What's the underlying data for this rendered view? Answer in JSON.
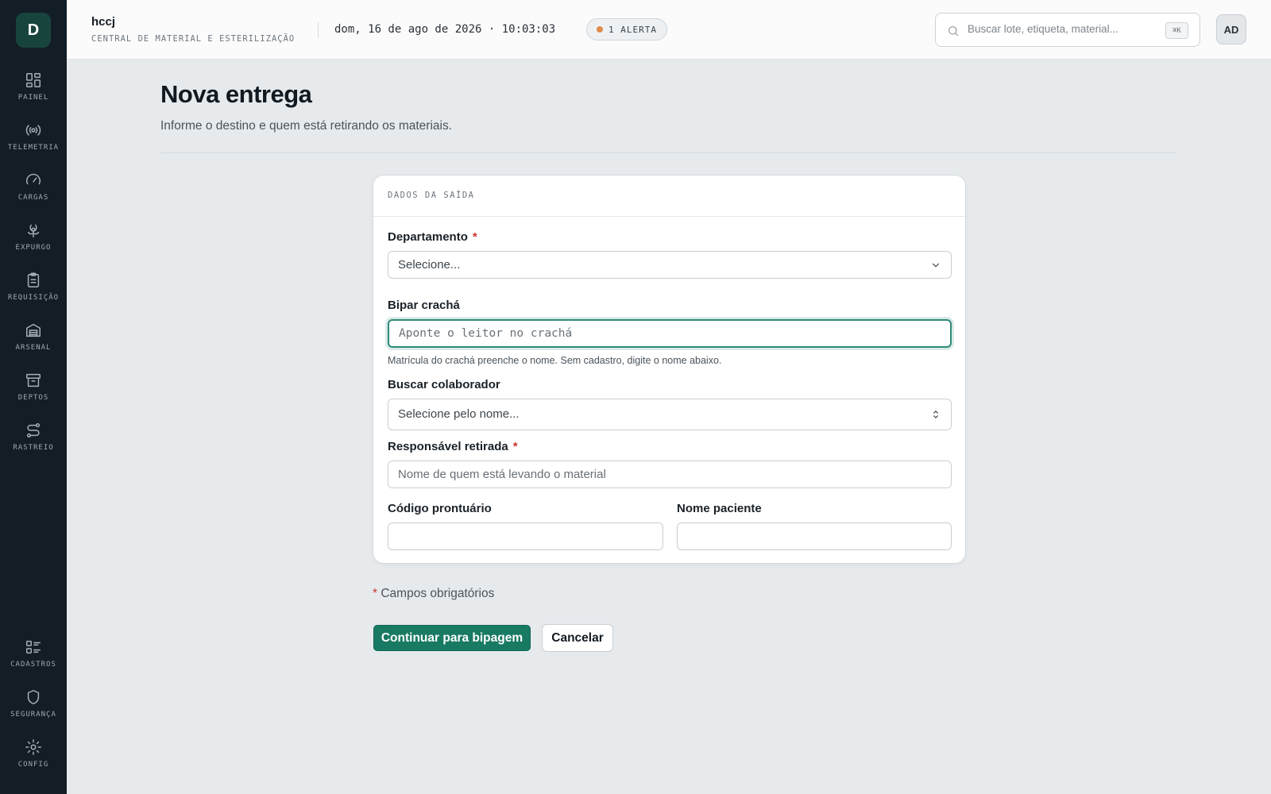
{
  "app": {
    "logo_letter": "D",
    "name": "hccj",
    "subtitle": "CENTRAL DE MATERIAL E ESTERILIZAÇÃO",
    "datetime": "dom, 16 de ago de 2026 · 10:03:03",
    "alert_label": "1 ALERTA",
    "alert_color": "#e08a4c",
    "accent_color": "#187a63"
  },
  "search": {
    "placeholder": "Buscar lote, etiqueta, material...",
    "shortcut": "⌘K"
  },
  "user": {
    "initials": "AD"
  },
  "sidebar": {
    "items": [
      {
        "label": "PAINEL",
        "icon": "grid-icon"
      },
      {
        "label": "TELEMETRIA",
        "icon": "broadcast-icon"
      },
      {
        "label": "CARGAS",
        "icon": "gauge-icon"
      },
      {
        "label": "EXPURGO",
        "icon": "biohazard-icon"
      },
      {
        "label": "REQUISIÇÃO",
        "icon": "clipboard-icon"
      },
      {
        "label": "ARSENAL",
        "icon": "warehouse-icon"
      },
      {
        "label": "DEPTOS",
        "icon": "archive-icon"
      },
      {
        "label": "RASTREIO",
        "icon": "route-icon"
      }
    ],
    "bottom_items": [
      {
        "label": "CADASTROS",
        "icon": "list-icon"
      },
      {
        "label": "SEGURANÇA",
        "icon": "shield-icon"
      },
      {
        "label": "CONFIG",
        "icon": "gear-icon"
      }
    ]
  },
  "page": {
    "title": "Nova entrega",
    "subtitle": "Informe o destino e quem está retirando os materiais."
  },
  "form": {
    "section_title": "DADOS DA SAÍDA",
    "department": {
      "label": "Departamento",
      "value": "Selecione..."
    },
    "badge": {
      "label": "Bipar crachá",
      "placeholder": "Aponte o leitor no crachá",
      "hint": "Matrícula do crachá preenche o nome. Sem cadastro, digite o nome abaixo."
    },
    "collaborator": {
      "label": "Buscar colaborador",
      "value": "Selecione pelo nome..."
    },
    "responsible": {
      "label": "Responsável retirada",
      "placeholder": "Nome de quem está levando o material"
    },
    "record_code": {
      "label": "Código prontuário",
      "value": ""
    },
    "patient_name": {
      "label": "Nome paciente",
      "value": ""
    },
    "required_mark": "*",
    "required_note": "Campos obrigatórios"
  },
  "actions": {
    "continue_label": "Continuar para bipagem",
    "cancel_label": "Cancelar"
  }
}
